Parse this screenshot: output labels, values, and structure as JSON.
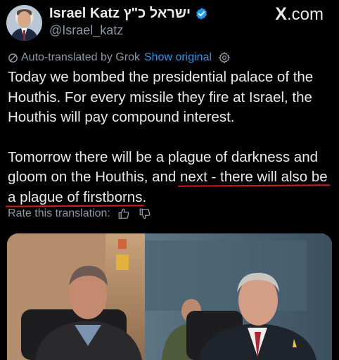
{
  "header": {
    "display_name": "Israel Katz ישראל כ\"ץ",
    "handle": "@Israel_katz",
    "site_logo_mark": "X",
    "site_logo_suffix": ".com",
    "verified_icon": "verified-badge-icon",
    "accent_color": "#1d9bf0"
  },
  "translation": {
    "label": "Auto-translated by Grok",
    "show_original": "Show original",
    "rate_label": "Rate this translation:",
    "icons": [
      "grok-icon",
      "settings-icon",
      "thumbs-up-icon",
      "thumbs-down-icon"
    ]
  },
  "tweet": {
    "line_1": "Today we bombed the presidential palace of the Houthis. For every missile they fire at Israel, the Houthis will pay compound interest.",
    "line_2_start": "Tomorrow there will be a plague of darkness and gloom on the Houthis, and ",
    "line_2_highlight_a": "next - there will also be",
    "line_2_highlight_b": "a plague of firstborns",
    "line_2_end": ".",
    "highlight_color": "#d41d1d"
  },
  "colors": {
    "background": "#000000",
    "text": "#e7e9ea",
    "secondary_text": "#8b98a5"
  }
}
